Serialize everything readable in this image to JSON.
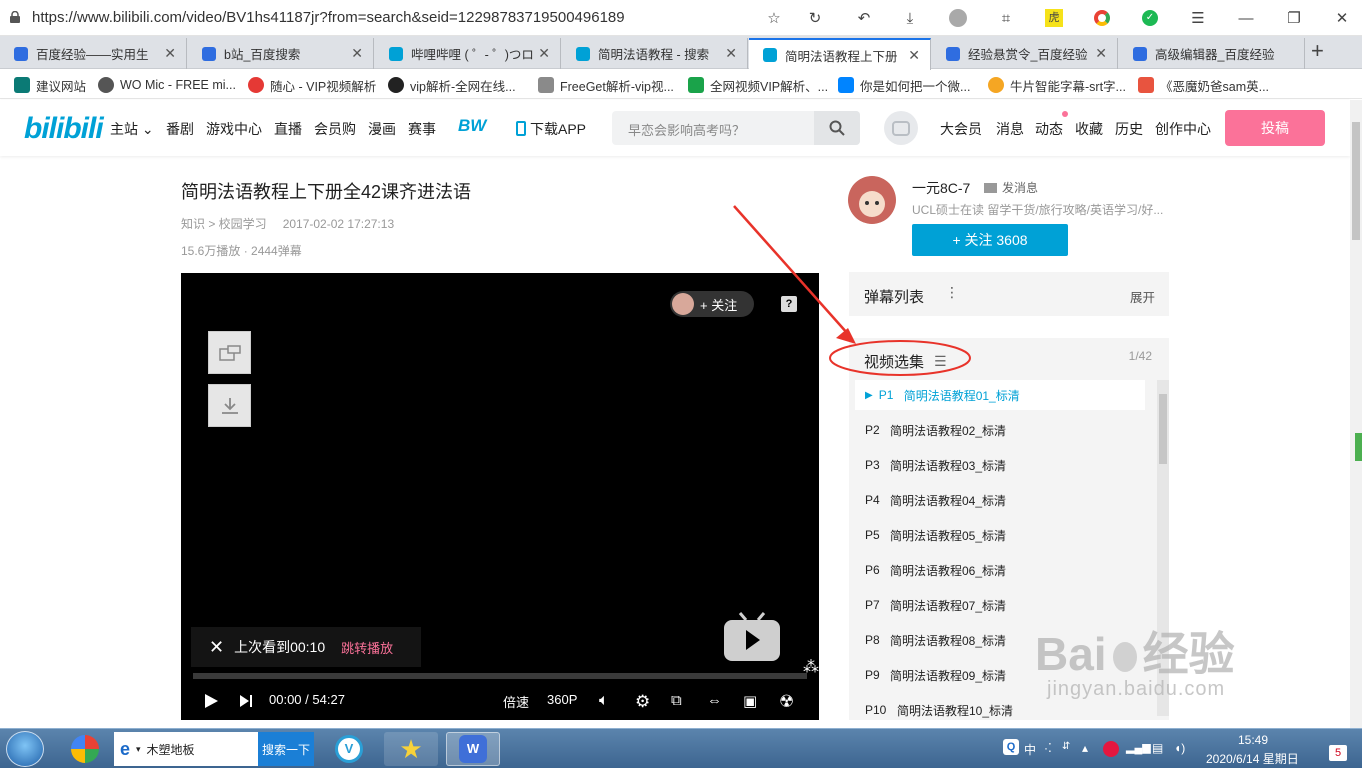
{
  "browser": {
    "url": "https://www.bilibili.com/video/BV1hs41187jr?from=search&seid=12298783719500496189",
    "tabs": [
      {
        "title": "百度经验——实用生",
        "active": false,
        "favicon_color": "#2f6de0"
      },
      {
        "title": "b站_百度搜索",
        "active": false,
        "favicon_color": "#2f6de0"
      },
      {
        "title": "哔哩哔哩 ( ゜- ゜)つロ",
        "active": false,
        "favicon_color": "#00a1d6"
      },
      {
        "title": "简明法语教程 - 搜索",
        "active": false,
        "favicon_color": "#00a1d6"
      },
      {
        "title": "简明法语教程上下册",
        "active": true,
        "favicon_color": "#00a1d6"
      },
      {
        "title": "经验悬赏令_百度经验",
        "active": false,
        "favicon_color": "#2f6de0"
      },
      {
        "title": "高级编辑器_百度经验",
        "active": false,
        "favicon_color": "#2f6de0"
      }
    ],
    "bookmarks": [
      {
        "label": "建议网站",
        "icon": "bing-icon",
        "color": "#0b7a75"
      },
      {
        "label": "WO Mic - FREE mi...",
        "icon": "globe-icon",
        "color": "#555555"
      },
      {
        "label": "随心 - VIP视频解析",
        "icon": "heart-icon",
        "color": "#e53935"
      },
      {
        "label": "vip解析-全网在线...",
        "icon": "moon-icon",
        "color": "#222222"
      },
      {
        "label": "FreeGet解析-vip视...",
        "icon": "fg-icon",
        "color": "#8a8a8a"
      },
      {
        "label": "全网视频VIP解析、...",
        "icon": "vx-icon",
        "color": "#1aa34a"
      },
      {
        "label": "你是如何把一个微...",
        "icon": "zhihu-icon",
        "color": "#0084ff"
      },
      {
        "label": "牛片智能字幕-srt字...",
        "icon": "niupian-icon",
        "color": "#f5a623"
      },
      {
        "label": "《恶魔奶爸sam英...",
        "icon": "jian-icon",
        "color": "#e8543f"
      }
    ]
  },
  "header": {
    "logo": "bilibili",
    "nav": [
      "主站",
      "番剧",
      "游戏中心",
      "直播",
      "会员购",
      "漫画",
      "赛事"
    ],
    "bw": "BW",
    "download": "下载APP",
    "search_placeholder": "早恋会影响高考吗？",
    "right_nav": [
      "大会员",
      "消息",
      "动态",
      "收藏",
      "历史",
      "创作中心"
    ],
    "upload": "投稿"
  },
  "video": {
    "title": "简明法语教程上下册全42课齐进法语",
    "category": "知识 > 校园学习",
    "date": "2017-02-02 17:27:13",
    "stats": "15.6万播放 · 2444弹幕"
  },
  "player": {
    "follow": "+ 关注",
    "help": "?",
    "resume_text": "上次看到00:10",
    "resume_link": "跳转播放",
    "current_time": "00:00",
    "separator": "/",
    "duration": "54:27",
    "speed": "倍速",
    "quality": "360P",
    "progress": 0.0
  },
  "uploader": {
    "name": "一元8C-7",
    "message": "发消息",
    "desc": "UCL硕士在读 留学干货/旅行攻略/英语学习/好...",
    "follow": "+ 关注 3608"
  },
  "danmu": {
    "title": "弹幕列表",
    "expand": "展开"
  },
  "playlist": {
    "title": "视频选集",
    "count": "1/42",
    "items": [
      {
        "p": "P1",
        "title": "简明法语教程01_标清"
      },
      {
        "p": "P2",
        "title": "简明法语教程02_标清"
      },
      {
        "p": "P3",
        "title": "简明法语教程03_标清"
      },
      {
        "p": "P4",
        "title": "简明法语教程04_标清"
      },
      {
        "p": "P5",
        "title": "简明法语教程05_标清"
      },
      {
        "p": "P6",
        "title": "简明法语教程06_标清"
      },
      {
        "p": "P7",
        "title": "简明法语教程07_标清"
      },
      {
        "p": "P8",
        "title": "简明法语教程08_标清"
      },
      {
        "p": "P9",
        "title": "简明法语教程09_标清"
      },
      {
        "p": "P10",
        "title": "简明法语教程10_标清"
      }
    ]
  },
  "watermark": {
    "logo": "Bai",
    "logo2": "经验",
    "url": "jingyan.baidu.com"
  },
  "taskbar": {
    "ie_label": "木塑地板",
    "ie_search": "搜索一下",
    "ime": "中",
    "time": "15:49",
    "date": "2020/6/14 星期日",
    "badge": "5"
  },
  "colors": {
    "bili_blue": "#00a1d6",
    "bili_pink": "#fb7299",
    "annotation_red": "#e8332a"
  }
}
